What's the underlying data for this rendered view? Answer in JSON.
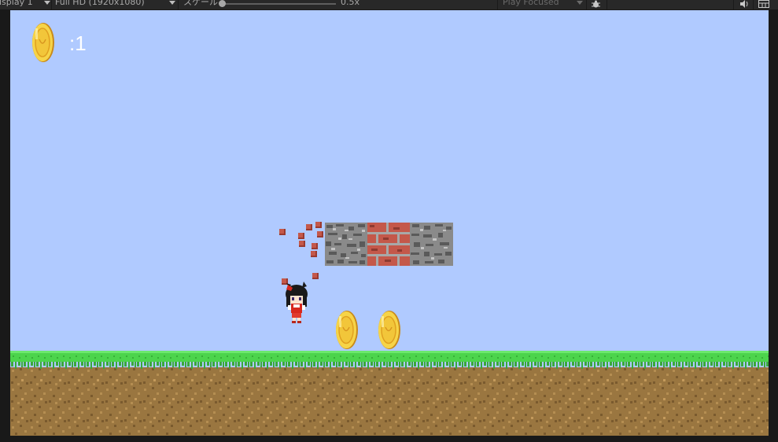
{
  "toolbar": {
    "display": "isplay 1",
    "resolution": "Full HD (1920x1080)",
    "scale_label": "スケール",
    "scale_value": "0.5x",
    "play_mode": "Play Focused",
    "scale_fraction": 0.0
  },
  "hud": {
    "coin_count": ":1"
  },
  "colors": {
    "sky": "#b0caff",
    "grass": "#4cd44c",
    "dirt": "#9a7640",
    "stone": "#8a8a8a",
    "brick": "#c4584a",
    "coin": "#f2c63a"
  },
  "icons": [
    "coin-icon",
    "bug-icon",
    "audio-icon",
    "stats-icon"
  ]
}
